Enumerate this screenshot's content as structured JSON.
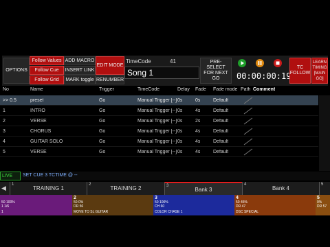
{
  "toolbar": {
    "options": "OPTIONS",
    "follow_values": "Follow Values",
    "follow_cue": "Follow Cue",
    "follow_grid": "Follow Grid",
    "add_macro": "ADD MACRO",
    "insert_link": "INSERT LINK",
    "mark_toggle": "MARK toggle",
    "edit_mode": "EDIT MODE",
    "renumber": "RENUMBER",
    "timecode_label": "TimeCode",
    "timecode_number": "41",
    "song_name": "Song 1",
    "preselect": "PRE-SELECT FOR NEXT GO",
    "clock": "00:00:00:19",
    "tc_follow": "TC FOLLOW",
    "learn_timing": "LEARN TIMING [MAIN GO]"
  },
  "icons": {
    "play": "play-icon",
    "pause": "pause-icon",
    "record": "record-icon"
  },
  "colors": {
    "accent_red": "#b00f0f",
    "selected_row": "#344250",
    "live_green": "#2aa02a"
  },
  "table": {
    "headers": [
      "No",
      "Name",
      "Trigger",
      "TimeCode",
      "Delay",
      "Fade",
      "Fade mode",
      "Path",
      "Comment"
    ],
    "rows": [
      {
        "no": ">> 0.5",
        "name": "preset",
        "trigger": "Go",
        "timecode": "Manual Trigger [--]",
        "delay": "0s",
        "fade": "0s",
        "fade_mode": "Default",
        "selected": true
      },
      {
        "no": "1",
        "name": "INTRO",
        "trigger": "Go",
        "timecode": "Manual Trigger [--]",
        "delay": "0s",
        "fade": "4s",
        "fade_mode": "Default",
        "selected": false
      },
      {
        "no": "2",
        "name": "VERSE",
        "trigger": "Go",
        "timecode": "Manual Trigger [--]",
        "delay": "0s",
        "fade": "2s",
        "fade_mode": "Default",
        "selected": false
      },
      {
        "no": "3",
        "name": "CHORUS",
        "trigger": "Go",
        "timecode": "Manual Trigger [--]",
        "delay": "0s",
        "fade": "4s",
        "fade_mode": "Default",
        "selected": false
      },
      {
        "no": "4",
        "name": "GUITAR SOLO",
        "trigger": "Go",
        "timecode": "Manual Trigger [--]",
        "delay": "0s",
        "fade": "4s",
        "fade_mode": "Default",
        "selected": false
      },
      {
        "no": "5",
        "name": "VERSE",
        "trigger": "Go",
        "timecode": "Manual Trigger [--]",
        "delay": "0s",
        "fade": "4s",
        "fade_mode": "Default",
        "selected": false
      }
    ]
  },
  "command_line": {
    "mode": "LIVE",
    "text": "SET CUE 3 TCTIME @ --"
  },
  "tabs": [
    {
      "num": "1",
      "label": "TRAINING 1",
      "active": false
    },
    {
      "num": "2",
      "label": "TRAINING 2",
      "active": false
    },
    {
      "num": "3",
      "label": "Bank 3",
      "active": true
    },
    {
      "num": "4",
      "label": "Bank 4",
      "active": false
    },
    {
      "num": "5",
      "label": "",
      "active": false
    }
  ],
  "faders": [
    {
      "num": "",
      "line1": "50     100%",
      "line2": "1    1/6",
      "name": "1",
      "color": "#6a1b7a"
    },
    {
      "num": "2",
      "line1": "50    0%",
      "line2": "DR 56",
      "name": "MOVE TO SL GUITAR",
      "color": "#5b3a10"
    },
    {
      "num": "3",
      "line1": "50    100%",
      "line2": "CH 60",
      "name": "COLOR CHASE 1",
      "color": "#1c2a9c"
    },
    {
      "num": "4",
      "line1": "50    45%",
      "line2": "DR 47",
      "name": "DSC SPECIAL",
      "color": "#8a3a0c"
    },
    {
      "num": "5",
      "line1": "0%",
      "line2": "DR 57",
      "name": "",
      "color": "#8a4e10"
    }
  ]
}
